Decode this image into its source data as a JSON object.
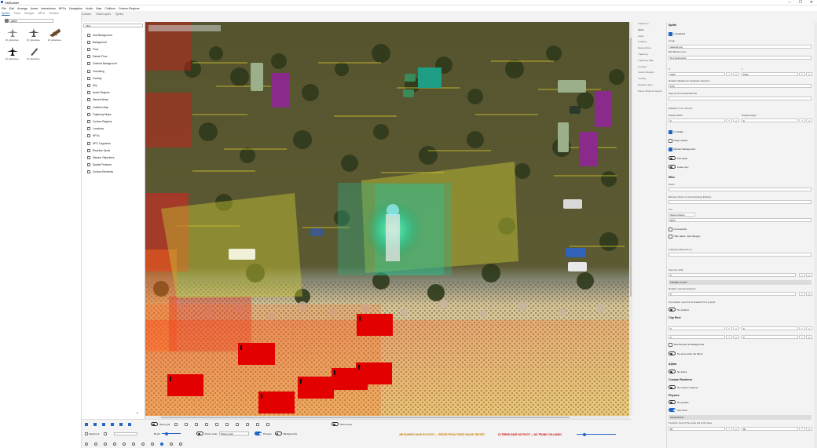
{
  "app": {
    "title": "SMBuilder"
  },
  "menu": [
    "File",
    "Edit",
    "Arrange",
    "Areas",
    "Interactions",
    "NPCs",
    "Navigation",
    "Audio",
    "Map",
    "Collision",
    "Custom Regions"
  ],
  "asset_panel": {
    "tabs": [
      "Sprites",
      "Trees",
      "Designs",
      "NPCs",
      "Vehicles"
    ],
    "active_tab": "Sprites",
    "search_value": "plane",
    "assets": [
      {
        "label": "sfl_plane1tee..",
        "icon": "plane-icon"
      },
      {
        "label": "sfl_plane1tee..",
        "icon": "plane-icon"
      },
      {
        "label": "sfl_plane1tee..",
        "icon": "plane-icon"
      },
      {
        "label": "sfl_plane1tee..",
        "icon": "plane-icon"
      },
      {
        "label": "sfl_plane1tee..",
        "icon": "plane-icon"
      }
    ]
  },
  "view_tabs": [
    "Collision",
    "Visual Layers",
    "Sprites"
  ],
  "tree": {
    "filter_placeholder": "Filter",
    "items": [
      "Sub-Background",
      "Background",
      "Floor",
      "Raised Floor",
      "Ordered Background",
      "Occluding",
      "Overlay",
      "Sky",
      "Audio Regions",
      "Named Areas",
      "Collision Map",
      "Trajectory Maps",
      "Custom Regions",
      "Locations",
      "NPCs",
      "NPC Cognizers",
      "Reactive Spots",
      "Mission Objectives",
      "Spatial Features",
      "Custom Elements"
    ],
    "expandable": [
      true,
      true,
      true,
      true,
      false,
      true,
      true,
      false,
      false,
      true,
      false,
      false,
      false,
      false,
      true,
      false,
      true,
      true,
      false,
      false
    ]
  },
  "bottom": {
    "show_grid_label": "Show grid",
    "snap_label": "Show trees",
    "alignment_label": "Alignment",
    "brush_label": "Brush",
    "draw_mode_label": "Draw mode",
    "layer_select": "Player path",
    "preview_label": "Preview",
    "backgrounds_label": "Backgrounds",
    "warning_orange": "456 BUSHES HAVE NO PIVOT — RESIZE FROM THESE IMAGE CENTER",
    "warning_red": "22 TREES HAVE NO PIVOT — NO TRUNK COLLISION"
  },
  "prop_nav": [
    "Transform",
    "Sprite",
    "Audio",
    "Collision",
    "Named Area",
    "Trajectory",
    "Trajectory Map",
    "Location",
    "Custom Region",
    "Overlay",
    "Reactive Spot",
    "Player Distance Region"
  ],
  "props": {
    "sprite_title": "Sprite",
    "is_enabled": "Is Enabled",
    "image_label": "Image",
    "image_value": "asteroid.png",
    "blend_label": "BlendMode Layer",
    "blend_value": "Non Destructive",
    "x_label": "X",
    "x_value": "4153",
    "y_label": "Y",
    "y_value": "2164",
    "rotation_label": "Rotation Radians (in Clockwise direction)",
    "rotation_value": "0.00",
    "tags_label": "Tags (comma separated list)",
    "display_label": "Display (Y) no 1-8 & pix",
    "display_w_label": "Display Width",
    "display_w_value": "0",
    "display_h_label": "Display Height",
    "display_h_value": "0",
    "is_visible": "Is Visible",
    "drag_locked": "Drag Locked",
    "render_bg": "Render Background",
    "full_depth": "Full depth",
    "world_only": "Lower only",
    "misc_title": "Misc",
    "name_label": "Name",
    "behavior_label": "Behavior Name to Used (blocking Entities)",
    "tint_label": "Tint",
    "tint_value": "Glass Ambient",
    "tint_extra": "#FFF",
    "invulnerable": "Invulnerable",
    "hide_label": "Hide (false: Intel hanger)",
    "path_label": "Trajectory Map look-up",
    "speed_label": "Speed (1-100)",
    "speed_value": "0",
    "frame_title": "FRAME COUNT",
    "rotation2_label": "Rotation (sometimes/pivot)",
    "rotation2_value": "0",
    "note": "For shadow: pivot line is shaded 0.5 of ground",
    "no_shadow": "No shadow",
    "clip_title": "Clip Rect",
    "clip_x": "0",
    "clip_y": "0",
    "clip_w": "0",
    "clip_h": "0",
    "also_render": "Also Render as Background",
    "no_flip": "No auto-rotate the Mirror",
    "alpha_title": "Alpha",
    "alpha_toggle": "No active",
    "custom_title": "Custom Renderer",
    "custom_toggle": "No custom renderer",
    "physics_title": "Physics",
    "physics_toggle": "No physics",
    "static_toggle": "Use Pivot",
    "collision_title": "FACE PIVOT",
    "pivot_note": "Footprint: pivot of the sprite sits at the base",
    "pivot_x": "50",
    "pivot_y": "90"
  }
}
